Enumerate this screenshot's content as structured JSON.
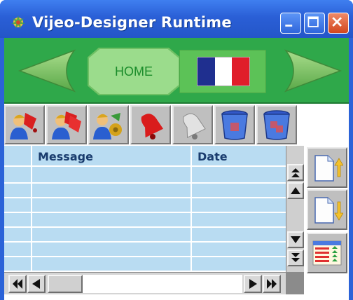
{
  "window": {
    "title": "Vijeo-Designer Runtime",
    "icons": {
      "app": "vijeo-app-icon",
      "minimize": "minimize-icon",
      "maximize": "maximize-icon",
      "close": "close-icon"
    },
    "colors": {
      "titlebar": "#2a5fd6",
      "close": "#d2471e"
    }
  },
  "navbar": {
    "home_label": "HOME",
    "background": "#2fa84a",
    "left_arrow_icon": "arrow-left-icon",
    "right_arrow_icon": "arrow-right-icon",
    "language_flag_icon": "french-flag-icon",
    "flag_colors": [
      "#1f2f8f",
      "#ffffff",
      "#e01e2a"
    ]
  },
  "toolbar": {
    "buttons": [
      {
        "icon": "acknowledge-alarm-user-icon"
      },
      {
        "icon": "acknowledge-all-alarms-user-icon"
      },
      {
        "icon": "alarm-settings-user-icon"
      },
      {
        "icon": "red-bell-icon"
      },
      {
        "icon": "silver-bell-icon"
      },
      {
        "icon": "trash-bin-icon"
      },
      {
        "icon": "trash-bin-all-icon"
      }
    ]
  },
  "table": {
    "columns": [
      "",
      "Message",
      "Date"
    ],
    "rows": [],
    "background": "#b9dcf2"
  },
  "side_buttons": [
    {
      "icon": "sort-ascending-page-icon"
    },
    {
      "icon": "sort-descending-page-icon"
    },
    {
      "icon": "alarm-table-view-icon"
    }
  ],
  "scrollbars": {
    "vertical": [
      "scroll-top-icon",
      "scroll-up-icon",
      "scroll-down-icon",
      "scroll-bottom-icon"
    ],
    "horizontal": [
      "scroll-first-icon",
      "scroll-left-icon",
      "scroll-right-icon",
      "scroll-last-icon"
    ]
  }
}
